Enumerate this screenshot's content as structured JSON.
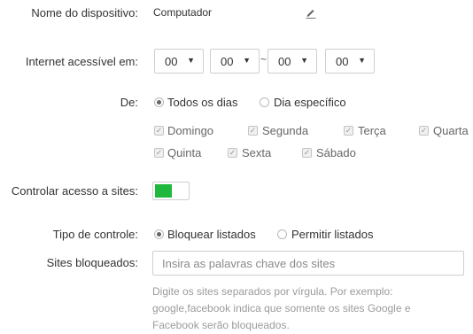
{
  "device": {
    "label": "Nome do dispositivo:",
    "value": "Computador",
    "edit_icon": "pencil-icon"
  },
  "internet": {
    "label": "Internet acessível em:",
    "selects": [
      "00",
      "00",
      "00",
      "00"
    ],
    "range_separator": "~"
  },
  "days": {
    "label": "De:",
    "modes": [
      {
        "label": "Todos os dias",
        "selected": true
      },
      {
        "label": "Dia específico",
        "selected": false
      }
    ],
    "weekdays": [
      {
        "label": "Domingo",
        "checked": true
      },
      {
        "label": "Segunda",
        "checked": true
      },
      {
        "label": "Terça",
        "checked": true
      },
      {
        "label": "Quarta",
        "checked": true
      },
      {
        "label": "Quinta",
        "checked": true
      },
      {
        "label": "Sexta",
        "checked": true
      },
      {
        "label": "Sábado",
        "checked": true
      }
    ]
  },
  "site_control": {
    "label": "Controlar acesso a sites:",
    "enabled": true,
    "on_color": "#1fb83c"
  },
  "control_type": {
    "label": "Tipo de controle:",
    "options": [
      {
        "label": "Bloquear listados",
        "selected": true
      },
      {
        "label": "Permitir listados",
        "selected": false
      }
    ]
  },
  "blocked_sites": {
    "label": "Sites bloqueados:",
    "value": "",
    "placeholder": "Insira as palavras chave dos sites",
    "help_lines": [
      "Digite os sites separados por vírgula. Por exemplo:",
      "google,facebook indica que somente os sites Google e",
      "Facebook serão bloqueados."
    ]
  }
}
